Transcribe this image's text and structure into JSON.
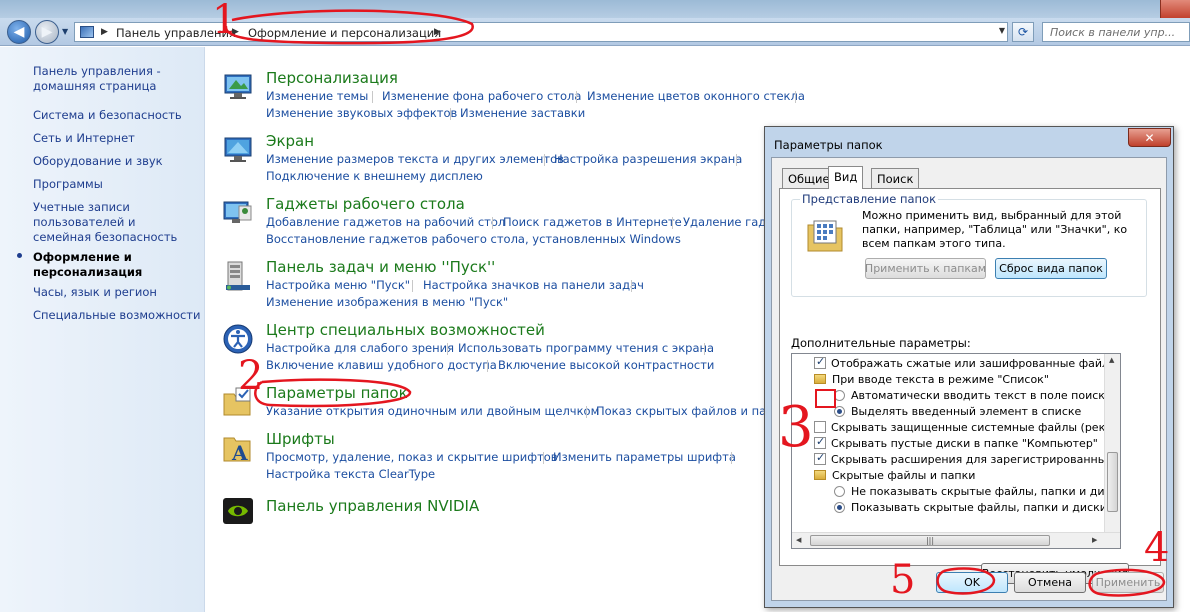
{
  "window": {
    "address_root": "Панель управления",
    "address_current": "Оформление и персонализация",
    "search_placeholder": "Поиск в панели упр..."
  },
  "sidebar": {
    "items": [
      "Панель управления - домашняя страница",
      "Система и безопасность",
      "Сеть и Интернет",
      "Оборудование и звук",
      "Программы",
      "Учетные записи пользователей и семейная безопасность",
      "Оформление и персонализация",
      "Часы, язык и регион",
      "Специальные возможности"
    ]
  },
  "categories": [
    {
      "title": "Персонализация",
      "links": [
        "Изменение темы",
        "Изменение фона рабочего стола",
        "Изменение цветов оконного стекла",
        "Изменение звуковых эффектов",
        "Изменение заставки"
      ]
    },
    {
      "title": "Экран",
      "links": [
        "Изменение размеров текста и других элементов",
        "Настройка разрешения экрана",
        "Подключение к внешнему дисплею"
      ]
    },
    {
      "title": "Гаджеты рабочего стола",
      "links": [
        "Добавление гаджетов на рабочий стол",
        "Поиск гаджетов в Интернете",
        "Удаление гадж",
        "Восстановление гаджетов рабочего стола, установленных Windows"
      ]
    },
    {
      "title": "Панель задач и меню ''Пуск''",
      "links": [
        "Настройка меню \"Пуск\"",
        "Настройка значков на панели задач",
        "Изменение изображения в меню \"Пуск\""
      ]
    },
    {
      "title": "Центр специальных возможностей",
      "links": [
        "Настройка для слабого зрения",
        "Использовать программу чтения с экрана",
        "Включение клавиш удобного доступа",
        "Включение высокой контрастности"
      ]
    },
    {
      "title": "Параметры папок",
      "links": [
        "Указание открытия одиночным или двойным щелчком",
        "Показ скрытых файлов и папо"
      ]
    },
    {
      "title": "Шрифты",
      "links": [
        "Просмотр, удаление, показ и скрытие шрифтов",
        "Изменить параметры шрифта",
        "Настройка текста ClearType"
      ]
    },
    {
      "title": "Панель управления NVIDIA",
      "links": []
    }
  ],
  "dialog": {
    "title": "Параметры папок",
    "close": "✕",
    "tabs": [
      "Общие",
      "Вид",
      "Поиск"
    ],
    "group_label": "Представление папок",
    "group_text": "Можно применить вид, выбранный для этой папки, например, \"Таблица\" или \"Значки\", ко всем папкам этого типа.",
    "apply_to_folders": "Применить к папкам",
    "reset_folders": "Сброс вида папок",
    "advanced_label": "Дополнительные параметры:",
    "tree": [
      "Отображать сжатые или зашифрованные файлы NTF",
      "При вводе текста в режиме \"Список\"",
      "Автоматически вводить текст в поле поиска",
      "Выделять введенный элемент в списке",
      "Скрывать защищенные системные файлы (рекомен,",
      "Скрывать пустые диски в папке \"Компьютер\"",
      "Скрывать расширения для зарегистрированных типо",
      "Скрытые файлы и папки",
      "Не показывать скрытые файлы, папки и диски",
      "Показывать скрытые файлы, папки и диски"
    ],
    "restore_defaults": "Восстановить умолчания",
    "ok": "OK",
    "cancel": "Отмена",
    "apply": "Применить"
  },
  "annotations": {
    "step1": "1",
    "step2": "2",
    "step3": "3",
    "step4": "4",
    "step5": "5",
    "color": "#e4161f"
  }
}
